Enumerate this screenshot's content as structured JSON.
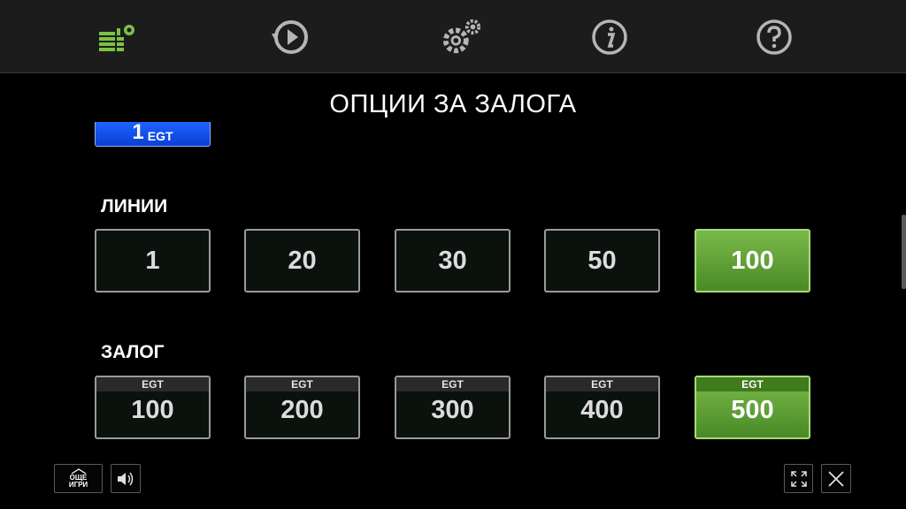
{
  "title": "ОПЦИИ ЗА ЗАЛОГА",
  "toolbar": {
    "icons": [
      "bet-settings-icon",
      "autoplay-icon",
      "settings-icon",
      "info-icon",
      "help-icon"
    ],
    "active_color": "#7cc242"
  },
  "denomination": {
    "value": "1",
    "currency": "EGT"
  },
  "lines": {
    "label": "ЛИНИИ",
    "options": [
      "1",
      "20",
      "30",
      "50",
      "100"
    ],
    "selected": "100"
  },
  "bet": {
    "label": "ЗАЛОГ",
    "currency": "EGT",
    "options": [
      "100",
      "200",
      "300",
      "400",
      "500"
    ],
    "selected": "500"
  },
  "bottom": {
    "more_games_line1": "ОЩЕ",
    "more_games_line2": "ИГРИ"
  }
}
